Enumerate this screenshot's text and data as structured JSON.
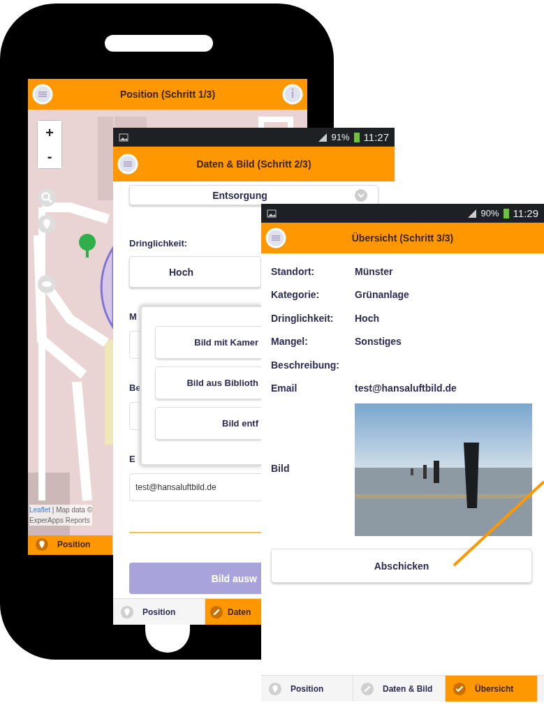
{
  "position_screen": {
    "title": "Position (Schritt 1/3)",
    "zoom_buttons": [
      "+",
      "-"
    ],
    "attribution_link": "Leaflet",
    "attribution_text": "| Map data ©",
    "credit": "ExperApps Reports",
    "tabs": [
      {
        "label": "Position",
        "selected": true
      }
    ]
  },
  "data_screen": {
    "status_bar": {
      "battery": "91%",
      "time": "11:27"
    },
    "title": "Daten & Bild (Schritt 2/3)",
    "form": [
      {
        "kind": "select",
        "value": "Entsorgung"
      },
      {
        "kind": "label",
        "text": "Dringlichkeit:"
      },
      {
        "kind": "select",
        "value": "Hoch"
      },
      {
        "kind": "label",
        "text": "M"
      },
      {
        "kind": "field"
      },
      {
        "kind": "label",
        "text": "Be"
      },
      {
        "kind": "field"
      },
      {
        "kind": "label",
        "text": "E"
      },
      {
        "kind": "field",
        "value": "test@hansaluftbild.de"
      },
      {
        "kind": "divider"
      },
      {
        "kind": "button",
        "label": "Bild ausw",
        "disabled": true
      }
    ],
    "photo_menu": [
      "Bild mit Kamer",
      "Bild aus Biblioth",
      "Bild entf"
    ],
    "tabs": [
      {
        "label": "Position",
        "selected": false
      },
      {
        "label": "Daten",
        "selected": true
      }
    ]
  },
  "summary_screen": {
    "status_bar": {
      "battery": "90%",
      "time": "11:29"
    },
    "title": "Übersicht (Schritt 3/3)",
    "rows": [
      {
        "kind": "text",
        "label": "Standort:",
        "value": "Münster"
      },
      {
        "kind": "text",
        "label": "Kategorie:",
        "value": "Grünanlage"
      },
      {
        "kind": "text",
        "label": "Dringlichkeit:",
        "value": "Hoch"
      },
      {
        "kind": "text",
        "label": "Mangel:",
        "value": "Sonstiges"
      },
      {
        "kind": "text",
        "label": "Beschreibung:"
      },
      {
        "kind": "text",
        "label": "Email",
        "value": "test@hansaluftbild.de"
      },
      {
        "kind": "photo",
        "label": "Bild"
      }
    ],
    "submit": "Abschicken",
    "tabs": [
      {
        "label": "Position",
        "selected": false
      },
      {
        "label": "Daten & Bild",
        "selected": false
      },
      {
        "label": "Übersicht",
        "selected": true
      }
    ]
  }
}
